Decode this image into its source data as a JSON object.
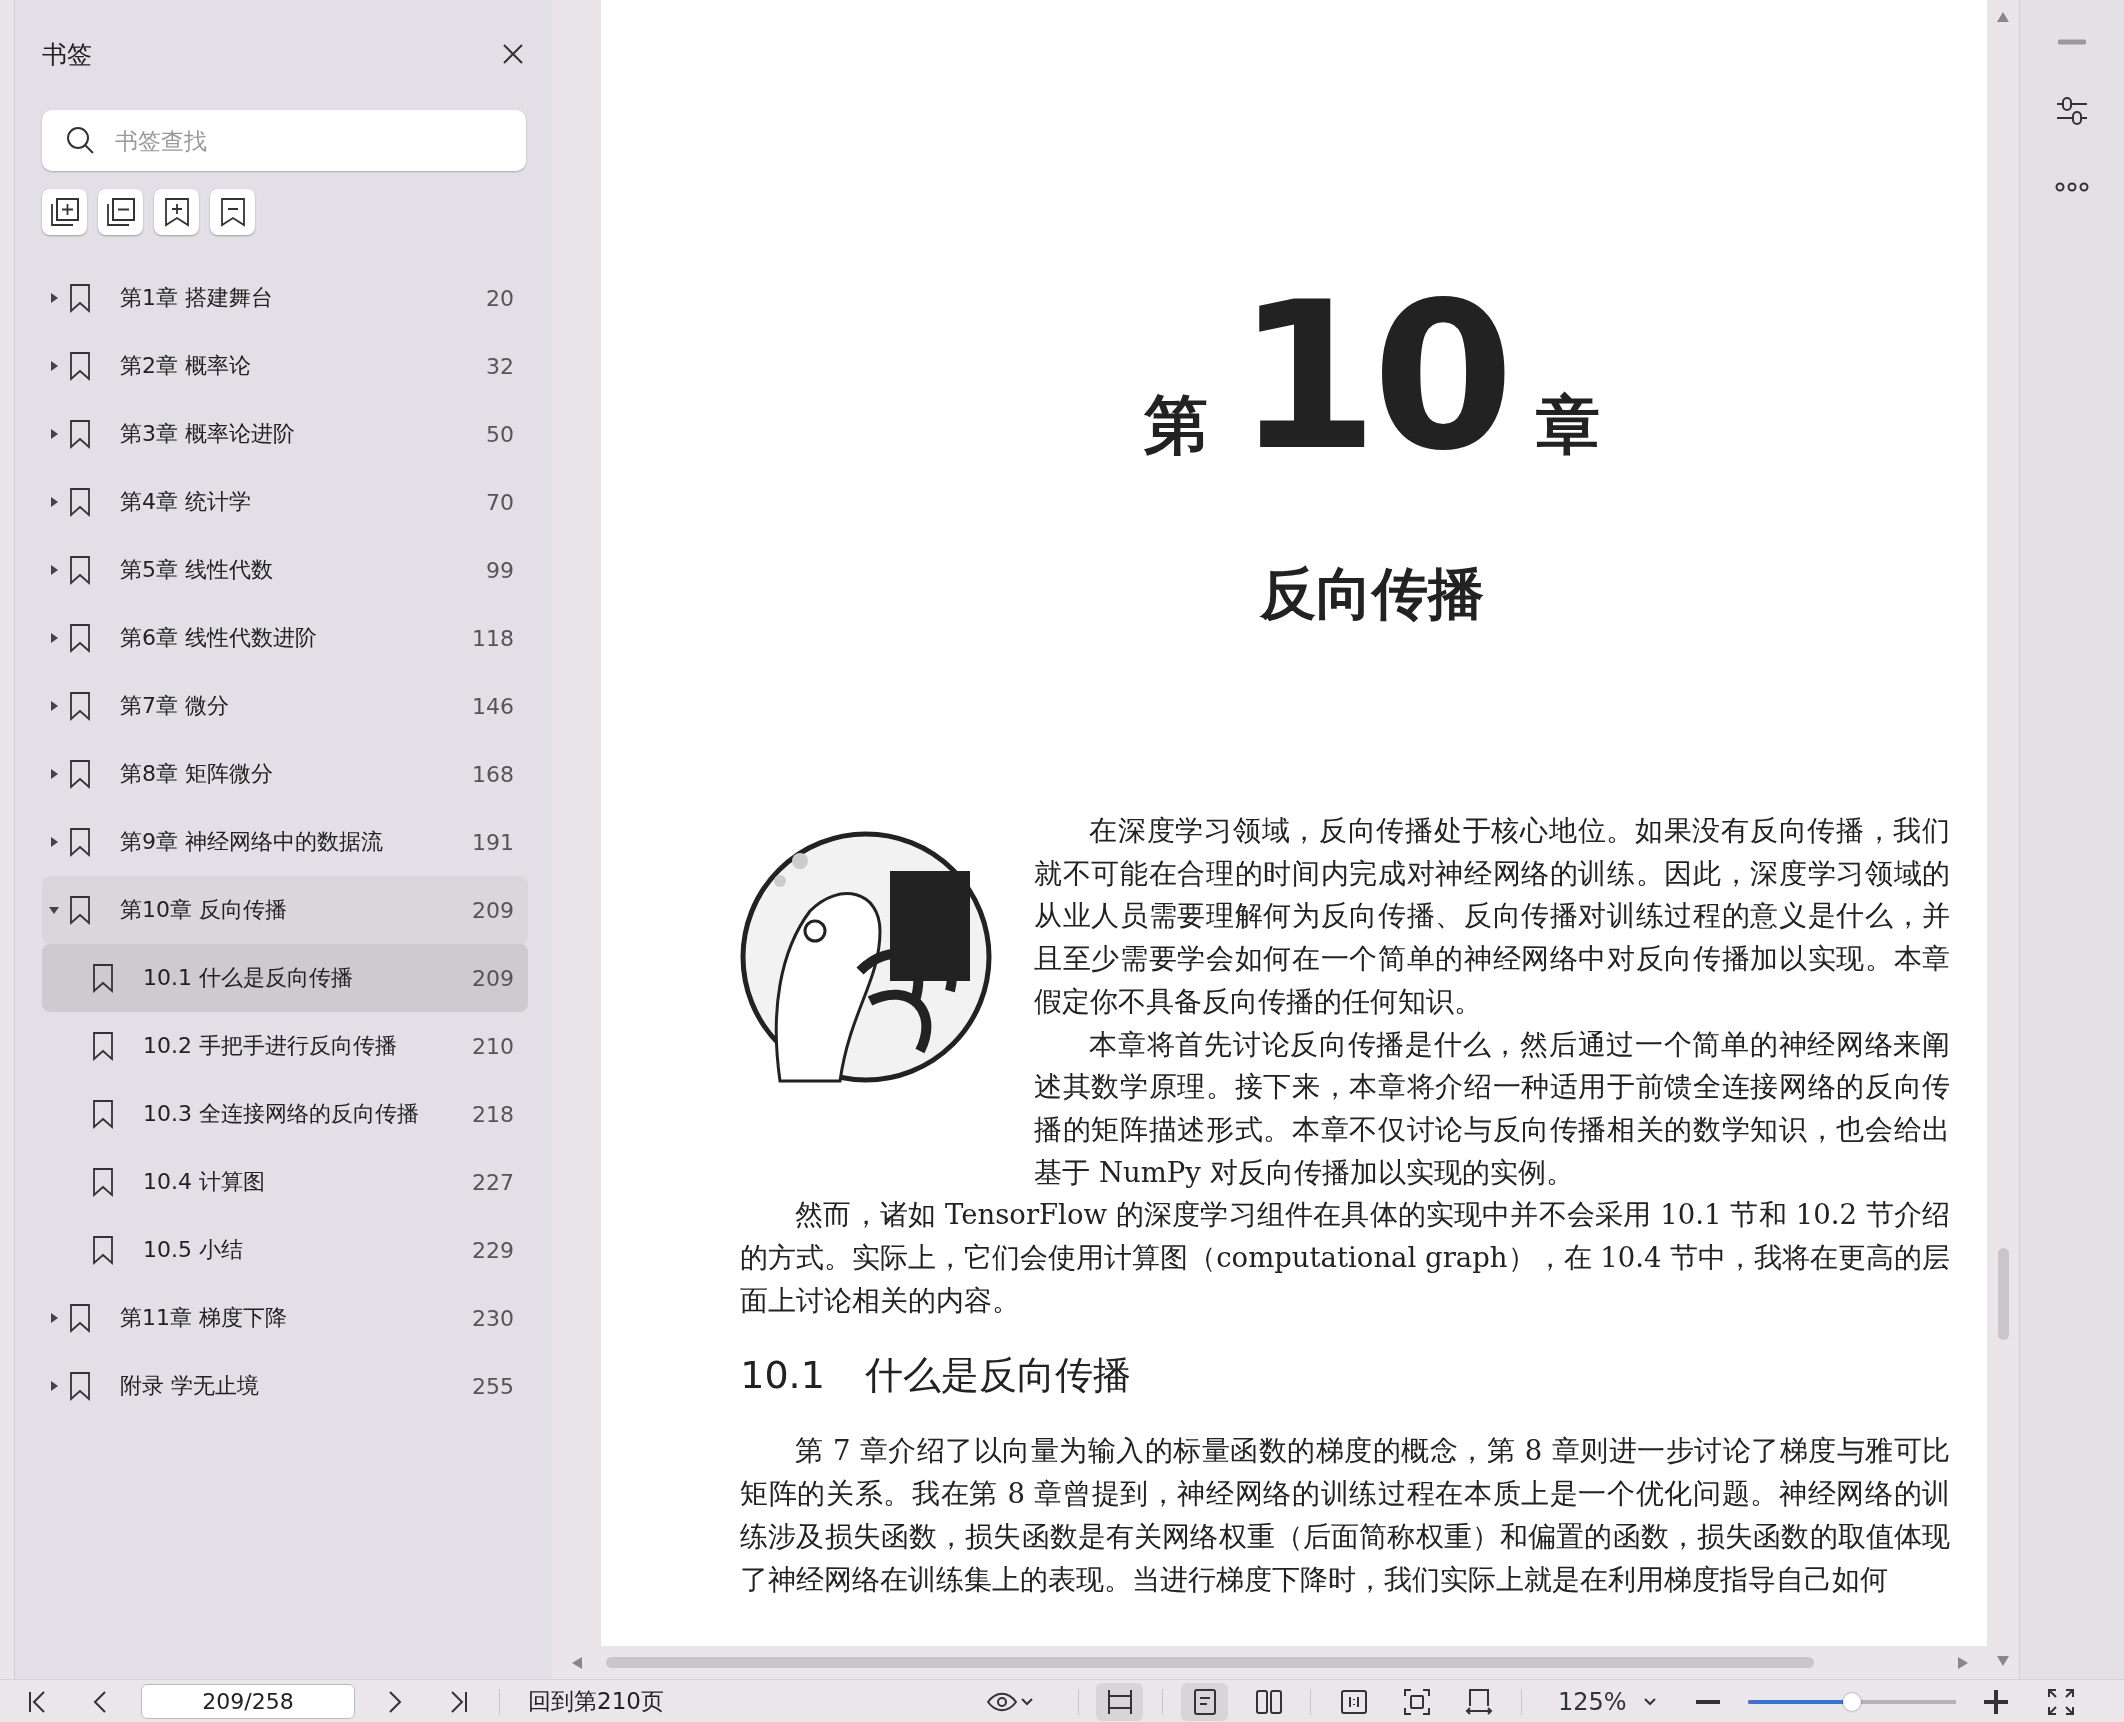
{
  "sidebar": {
    "title": "书签",
    "search": {
      "placeholder": "书签查找"
    },
    "bookmarks": [
      {
        "label": "第1章 搭建舞台",
        "page": "20",
        "expanded": false,
        "selected": false
      },
      {
        "label": "第2章 概率论",
        "page": "32",
        "expanded": false,
        "selected": false
      },
      {
        "label": "第3章 概率论进阶",
        "page": "50",
        "expanded": false,
        "selected": false
      },
      {
        "label": "第4章 统计学",
        "page": "70",
        "expanded": false,
        "selected": false
      },
      {
        "label": "第5章 线性代数",
        "page": "99",
        "expanded": false,
        "selected": false
      },
      {
        "label": "第6章 线性代数进阶",
        "page": "118",
        "expanded": false,
        "selected": false
      },
      {
        "label": "第7章 微分",
        "page": "146",
        "expanded": false,
        "selected": false
      },
      {
        "label": "第8章 矩阵微分",
        "page": "168",
        "expanded": false,
        "selected": false
      },
      {
        "label": "第9章 神经网络中的数据流",
        "page": "191",
        "expanded": false,
        "selected": false
      },
      {
        "label": "第10章 反向传播",
        "page": "209",
        "expanded": true,
        "selected": false,
        "children": [
          {
            "label": "10.1 什么是反向传播",
            "page": "209",
            "selected": true
          },
          {
            "label": "10.2 手把手进行反向传播",
            "page": "210",
            "selected": false
          },
          {
            "label": "10.3 全连接网络的反向传播",
            "page": "218",
            "selected": false
          },
          {
            "label": "10.4 计算图",
            "page": "227",
            "selected": false
          },
          {
            "label": "10.5 小结",
            "page": "229",
            "selected": false
          }
        ]
      },
      {
        "label": "第11章 梯度下降",
        "page": "230",
        "expanded": false,
        "selected": false
      },
      {
        "label": "附录 学无止境",
        "page": "255",
        "expanded": false,
        "selected": false
      }
    ]
  },
  "page": {
    "chapter_prefix": "第",
    "chapter_number": "10",
    "chapter_suffix": "章",
    "chapter_title": "反向传播",
    "intro_paragraphs": [
      "在深度学习领域，反向传播处于核心地位。如果没有反向传播，我们就不可能在合理的时间内完成对神经网络的训练。因此，深度学习领域的从业人员需要理解何为反向传播、反向传播对训练过程的意义是什么，并且至少需要学会如何在一个简单的神经网络中对反向传播加以实现。本章假定你不具备反向传播的任何知识。",
      "本章将首先讨论反向传播是什么，然后通过一个简单的神经网络来阐述其数学原理。接下来，本章将介绍一种适用于前馈全连接网络的反向传播的矩阵描述形式。本章不仅讨论与反向传播相关的数学知识，也会给出基于 NumPy 对反向传播加以实现的实例。",
      "然而，诸如 TensorFlow 的深度学习组件在具体的实现中并不会采用 10.1 节和 10.2 节介绍的方式。实际上，它们会使用计算图（computational graph），在 10.4 节中，我将在更高的层面上讨论相关的内容。"
    ],
    "section": {
      "number": "10.1",
      "title": "什么是反向传播"
    },
    "paragraphs": [
      "第 7 章介绍了以向量为输入的标量函数的梯度的概念，第 8 章则进一步讨论了梯度与雅可比矩阵的关系。我在第 8 章曾提到，神经网络的训练过程在本质上是一个优化问题。神经网络的训练涉及损失函数，损失函数是有关网络权重（后面简称权重）和偏置的函数，损失函数的取值体现了神经网络在训练集上的表现。当进行梯度下降时，我们实际上就是在利用梯度指导自己如何"
    ]
  },
  "toolbar": {
    "page_field": "209/258",
    "goto_link": "回到第210页",
    "layout_buttons": [
      {
        "kind": "continuous",
        "selected": true
      },
      {
        "kind": "single",
        "selected": true
      },
      {
        "kind": "double",
        "selected": false
      }
    ],
    "zoom": "125%",
    "zoom_slider": {
      "level": 0.5
    }
  }
}
